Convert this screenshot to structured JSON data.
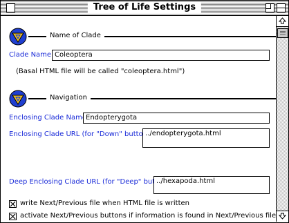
{
  "window": {
    "title": "Tree of Life Settings"
  },
  "sections": {
    "clade": {
      "header": "Name of Clade"
    },
    "navigation": {
      "header": "Navigation"
    }
  },
  "clade_name": {
    "label": "Clade Name:",
    "value": "Coleoptera",
    "note": "(Basal HTML file will be called \"coleoptera.html\")"
  },
  "enclosing_clade_name": {
    "label": "Enclosing Clade Name:",
    "value": "Endopterygota"
  },
  "enclosing_clade_url": {
    "label": "Enclosing Clade URL (for \"Down\" button):",
    "value": "../endopterygota.html"
  },
  "deep_enclosing_clade_url": {
    "label": "Deep Enclosing Clade URL (for \"Deep\" button):",
    "value": "../hexapoda.html"
  },
  "checkboxes": [
    {
      "label": "write Next/Previous file when HTML file is written",
      "checked": true
    },
    {
      "label": "activate Next/Previous buttons if information is found in Next/Previous file",
      "checked": true
    }
  ],
  "colors": {
    "label_blue": "#1a2bd8",
    "logo_blue": "#1f3fd0",
    "logo_yellow": "#f0c020"
  },
  "icons": {
    "section_logo": "tree-of-life-logo-icon"
  }
}
